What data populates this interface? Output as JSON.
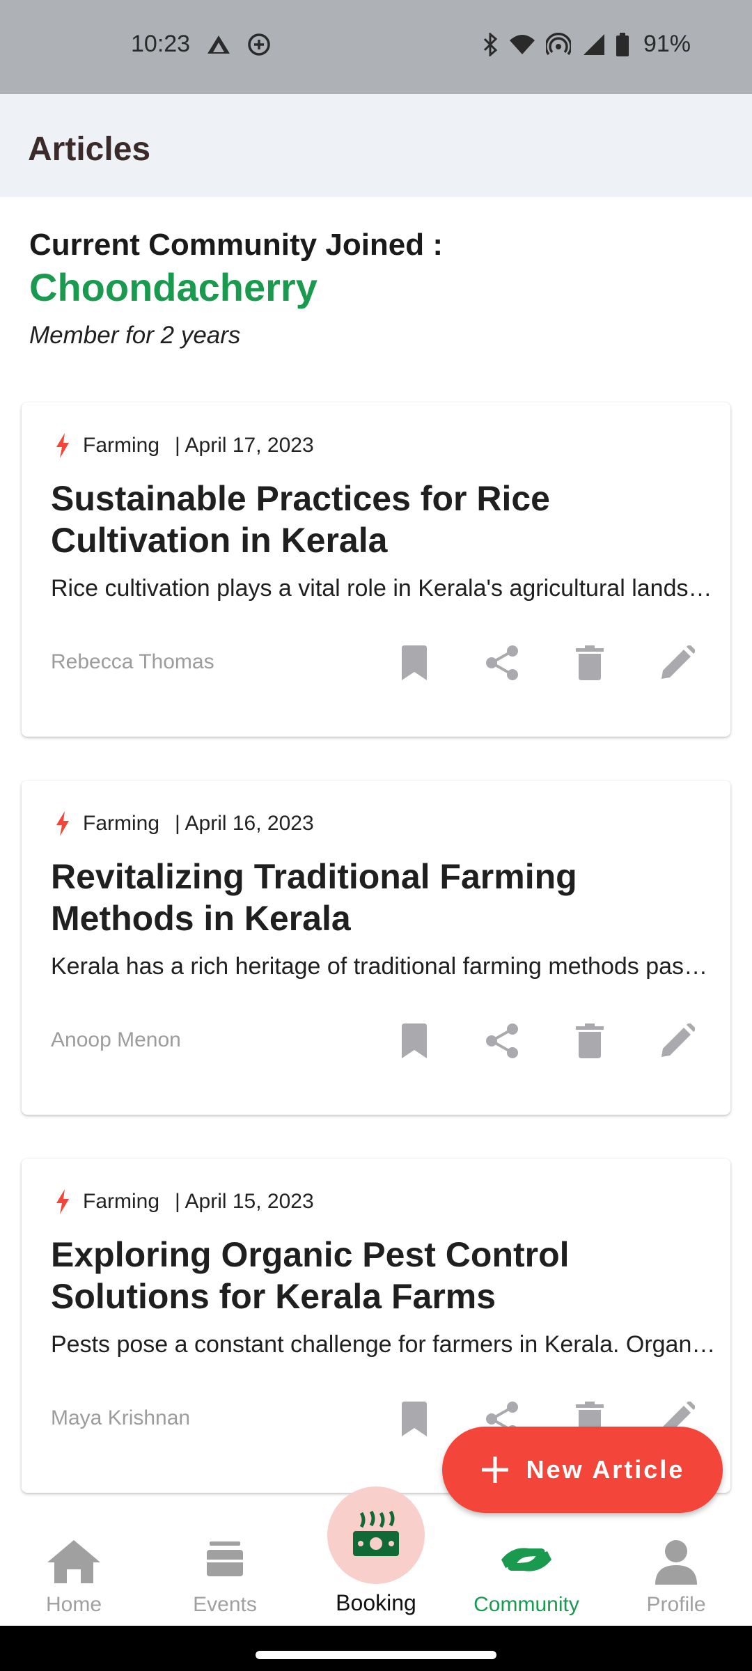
{
  "status_bar": {
    "time": "10:23",
    "battery": "91%",
    "icons": [
      "drive-icon",
      "data-saver-icon",
      "bluetooth-icon",
      "wifi-icon",
      "hotspot-icon",
      "signal-icon",
      "battery-icon"
    ]
  },
  "header": {
    "title": "Articles"
  },
  "community": {
    "label": "Current Community Joined :",
    "name": "Choondacherry",
    "membership": "Member for 2 years"
  },
  "articles": [
    {
      "category": "Farming",
      "date": "| April 17, 2023",
      "title": "Sustainable Practices for Rice Cultivation in Kerala",
      "excerpt": "Rice cultivation plays a vital role in Kerala's agricultural landscape and economy.",
      "author": "Rebecca Thomas"
    },
    {
      "category": "Farming",
      "date": "| April 16, 2023",
      "title": "Revitalizing Traditional Farming Methods in Kerala",
      "excerpt": "Kerala has a rich heritage of traditional farming methods passed down generations.",
      "author": "Anoop Menon"
    },
    {
      "category": "Farming",
      "date": "| April 15, 2023",
      "title": "Exploring Organic Pest Control Solutions for Kerala Farms",
      "excerpt": "Pests pose a constant challenge for farmers in Kerala. Organic methods offer relief.",
      "author": "Maya Krishnan"
    }
  ],
  "fab": {
    "label": "New Article"
  },
  "nav": {
    "home": "Home",
    "events": "Events",
    "booking": "Booking",
    "community": "Community",
    "profile": "Profile"
  },
  "colors": {
    "accent_green": "#1a9a4f",
    "fab_red": "#f4453a",
    "bolt_red": "#f4453a",
    "icon_grey": "#a9a9ae"
  }
}
